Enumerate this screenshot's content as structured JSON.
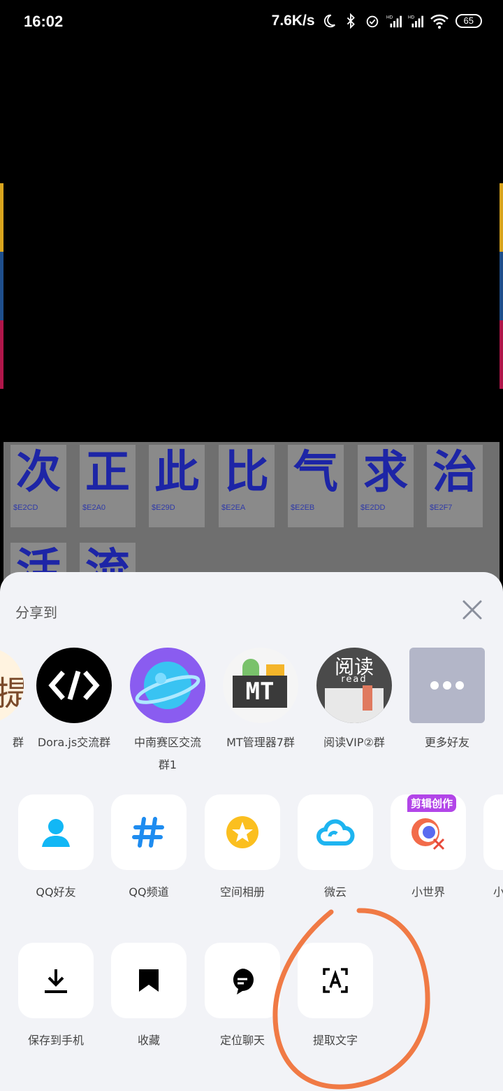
{
  "status_bar": {
    "time": "16:02",
    "net_speed": "7.6K/s",
    "battery": "65",
    "icons": [
      "moon-icon",
      "bluetooth-icon",
      "alarm-icon",
      "signal-hd-icon",
      "signal-hd-icon",
      "wifi-icon",
      "battery-icon"
    ]
  },
  "background": {
    "glyphs": [
      {
        "char": "次",
        "code": "$E2CD"
      },
      {
        "char": "正",
        "code": "$E2A0"
      },
      {
        "char": "此",
        "code": "$E29D"
      },
      {
        "char": "比",
        "code": "$E2EA"
      },
      {
        "char": "气",
        "code": "$E2EB"
      },
      {
        "char": "求",
        "code": "$E2DD"
      },
      {
        "char": "治",
        "code": "$E2F7"
      },
      {
        "char": "活",
        "code": ""
      },
      {
        "char": "流",
        "code": ""
      }
    ],
    "edge_colors": {
      "top": "#d9a51e",
      "middle": "#1f4f8c",
      "bottom": "#b0164a"
    }
  },
  "share_sheet": {
    "title": "分享到",
    "contacts": [
      {
        "label": "群",
        "avatar_text": "提"
      },
      {
        "label": "Dora.js交流群",
        "avatar_text": "</>"
      },
      {
        "label": "中南赛区交流群1",
        "label_line1": "中南赛区交流",
        "label_line2": "群1"
      },
      {
        "label": "MT管理器7群",
        "avatar_text": "MT"
      },
      {
        "label": "阅读VIP②群",
        "avatar_text": "阅读",
        "avatar_sub": "read"
      },
      {
        "label": "更多好友"
      }
    ],
    "apps": [
      {
        "label": "QQ好友",
        "icon": "qq-friend-icon"
      },
      {
        "label": "QQ频道",
        "icon": "hash-icon"
      },
      {
        "label": "空间相册",
        "icon": "qzone-album-icon"
      },
      {
        "label": "微云",
        "icon": "cloud-icon"
      },
      {
        "label": "小世界",
        "icon": "small-world-icon",
        "badge": "剪辑创作"
      },
      {
        "label": "小"
      }
    ],
    "actions": [
      {
        "label": "保存到手机",
        "icon": "download-icon"
      },
      {
        "label": "收藏",
        "icon": "bookmark-icon"
      },
      {
        "label": "定位聊天",
        "icon": "chat-locate-icon"
      },
      {
        "label": "提取文字",
        "icon": "text-extract-icon"
      }
    ],
    "annotation_color": "#f07a45"
  }
}
